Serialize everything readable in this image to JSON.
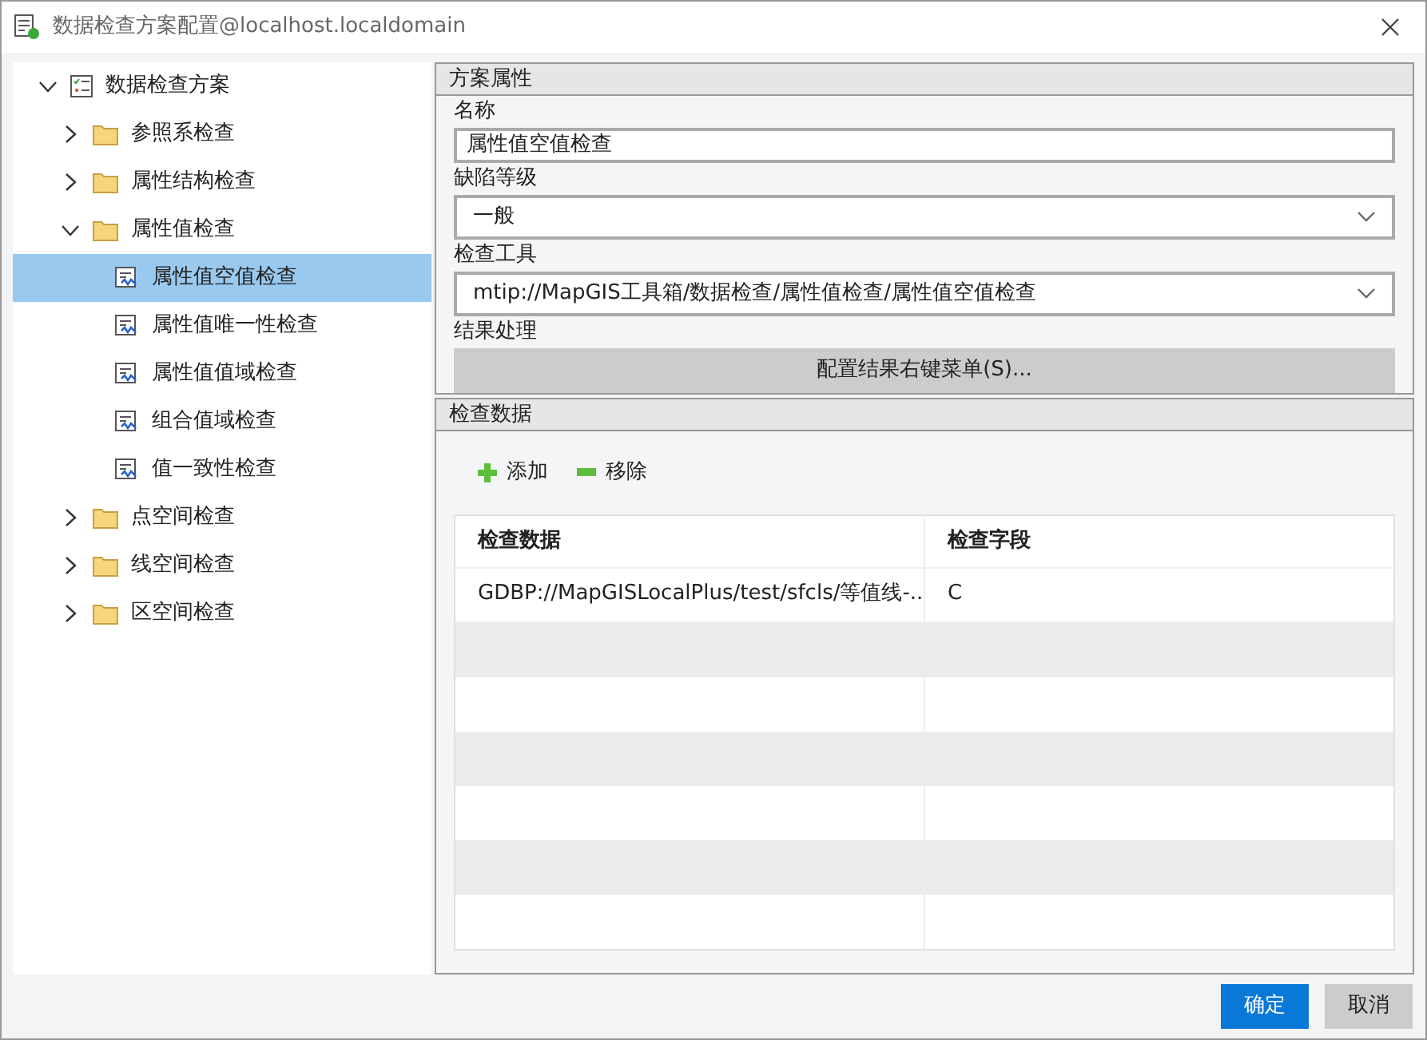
{
  "window": {
    "title": "数据检查方案配置@localhost.localdomain"
  },
  "tree": [
    {
      "label": "数据检查方案",
      "kind": "scheme",
      "expanded": true,
      "selected": false,
      "children": [
        {
          "label": "参照系检查",
          "kind": "folder",
          "expanded": false,
          "selected": false
        },
        {
          "label": "属性结构检查",
          "kind": "folder",
          "expanded": false,
          "selected": false
        },
        {
          "label": "属性值检查",
          "kind": "folder",
          "expanded": true,
          "selected": false,
          "children": [
            {
              "label": "属性值空值检查",
              "kind": "check",
              "selected": true
            },
            {
              "label": "属性值唯一性检查",
              "kind": "check",
              "selected": false
            },
            {
              "label": "属性值值域检查",
              "kind": "check",
              "selected": false
            },
            {
              "label": "组合值域检查",
              "kind": "check",
              "selected": false
            },
            {
              "label": "值一致性检查",
              "kind": "check",
              "selected": false
            }
          ]
        },
        {
          "label": "点空间检查",
          "kind": "folder",
          "expanded": false,
          "selected": false
        },
        {
          "label": "线空间检查",
          "kind": "folder",
          "expanded": false,
          "selected": false
        },
        {
          "label": "区空间检查",
          "kind": "folder",
          "expanded": false,
          "selected": false
        }
      ]
    }
  ],
  "properties": {
    "title": "方案属性",
    "name_label": "名称",
    "name_value": "属性值空值检查",
    "level_label": "缺陷等级",
    "level_value": "一般",
    "tool_label": "检查工具",
    "tool_value": "mtip://MapGIS工具箱/数据检查/属性值检查/属性值空值检查",
    "result_label": "结果处理",
    "result_button": "配置结果右键菜单(S)..."
  },
  "check_data": {
    "title": "检查数据",
    "add": "添加",
    "remove": "移除",
    "columns": [
      "检查数据",
      "检查字段"
    ],
    "rows": [
      [
        "GDBP://MapGISLocalPlus/test/sfcls/等值线-...",
        "C"
      ]
    ]
  },
  "buttons": [
    {
      "label": "确定",
      "kind": "primary"
    },
    {
      "label": "取消",
      "kind": "secondary"
    }
  ]
}
